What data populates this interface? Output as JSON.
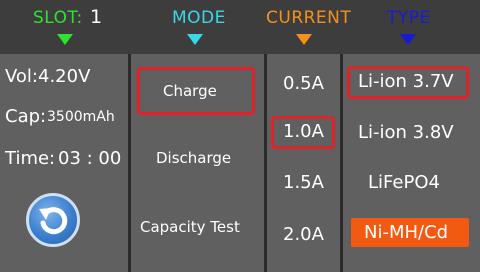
{
  "header": {
    "slot_label": "SLOT:",
    "slot_value": "1",
    "mode_label": "MODE",
    "current_label": "CURRENT",
    "type_label": "TYPE"
  },
  "colors": {
    "slot": "#2ee32e",
    "mode": "#38d8e8",
    "current": "#f5901e",
    "type": "#1a1ad6",
    "selection_border": "#e0232b",
    "nimh_bg": "#f25a12"
  },
  "status": {
    "vol": "Vol:4.20V",
    "cap_label": "Cap:",
    "cap_value": "3500mAh",
    "time_label": "Time:",
    "time_value": "03 : 00"
  },
  "modes": [
    "Charge",
    "Discharge",
    "Capacity Test"
  ],
  "currents": [
    "0.5A",
    "1.0A",
    "1.5A",
    "2.0A"
  ],
  "types": [
    "Li-ion 3.7V",
    "Li-ion 3.8V",
    "LiFePO4",
    "Ni-MH/Cd"
  ],
  "selected": {
    "mode": "Charge",
    "current": "1.0A",
    "type": "Li-ion 3.7V"
  },
  "icons": {
    "back": "undo-arrow-icon"
  }
}
